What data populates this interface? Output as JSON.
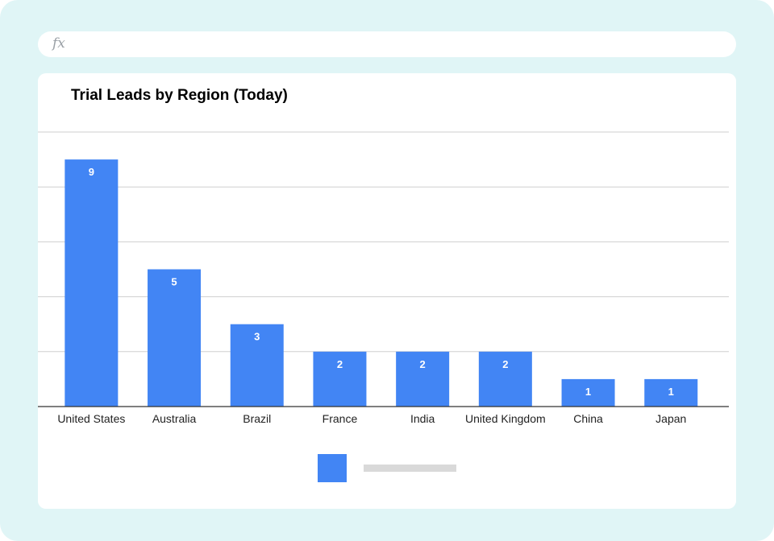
{
  "formula_bar": {
    "icon": "fx-icon",
    "label": "fx"
  },
  "chart_data": {
    "type": "bar",
    "title": "Trial Leads by Region (Today)",
    "categories": [
      "United States",
      "Australia",
      "Brazil",
      "France",
      "India",
      "United Kingdom",
      "China",
      "Japan"
    ],
    "values": [
      9,
      5,
      3,
      2,
      2,
      2,
      1,
      1
    ],
    "ylim": [
      0,
      10
    ],
    "y_tick_step": 2,
    "y_tick_labels_shown": false,
    "data_labels": true,
    "grid": true,
    "legend": "bottom",
    "series_color": "#4285f4"
  }
}
